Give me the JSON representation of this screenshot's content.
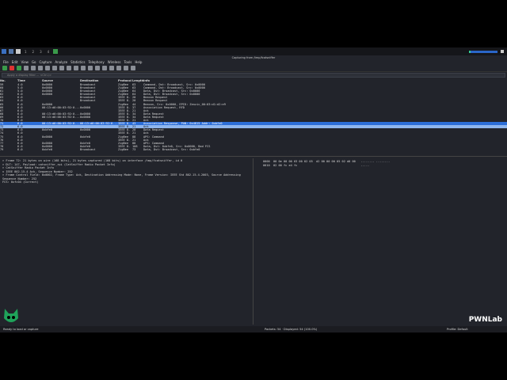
{
  "window": {
    "title": "Capturing from /tmp/fcatsniffer",
    "workspaces": [
      "1",
      "2",
      "3",
      "4"
    ]
  },
  "menu": [
    "File",
    "Edit",
    "View",
    "Go",
    "Capture",
    "Analyze",
    "Statistics",
    "Telephony",
    "Wireless",
    "Tools",
    "Help"
  ],
  "filter": {
    "placeholder": "Apply a display filter ... <Ctrl-/>"
  },
  "columns": [
    "No.",
    "Time",
    "Source",
    "Destination",
    "Protocol",
    "Length",
    "Info"
  ],
  "packets": [
    [
      "59",
      "4.0",
      "0x0000",
      "Broadcast",
      "ZigBee",
      "63",
      "Command, Dst: Broadcast, Src: 0x0000"
    ],
    [
      "60",
      "5.0",
      "0x0000",
      "Broadcast",
      "ZigBee",
      "63",
      "Command, Dst: Broadcast, Src: 0x0000"
    ],
    [
      "61",
      "5.0",
      "0x0000",
      "Broadcast",
      "ZigBee",
      "64",
      "Data, Dst: Broadcast, Src: 0x0000"
    ],
    [
      "62",
      "6.0",
      "0x0000",
      "Broadcast",
      "ZigBee",
      "64",
      "Data, Dst: Broadcast, Src: 0x0000"
    ],
    [
      "63",
      "6.0",
      "",
      "Broadcast",
      "IEEE 8.",
      "20",
      "Beacon Request"
    ],
    [
      "64",
      "6.0",
      "",
      "Broadcast",
      "IEEE 8.",
      "20",
      "Beacon Request"
    ],
    [
      "65",
      "6.0",
      "0x0000",
      "",
      "ZigBee",
      "44",
      "Beacon, Src: 0x0000, EPID: Zenzic_00:03:d1:d2:e9"
    ],
    [
      "66",
      "6.0",
      "00:13:d0:00:03:92:0...",
      "0x0000",
      "IEEE 8.",
      "37",
      "Association Request, RFD"
    ],
    [
      "67",
      "6.0",
      "",
      "",
      "IEEE 8.",
      "21",
      "Ack"
    ],
    [
      "68",
      "6.0",
      "00:13:d0:00:03:92:0...",
      "0x0000",
      "IEEE 8.",
      "34",
      "Data Request"
    ],
    [
      "69",
      "6.0",
      "00:13:d0:00:03:92:0...",
      "0x0000",
      "IEEE 8.",
      "34",
      "Data Request"
    ],
    [
      "70",
      "6.0",
      "",
      "",
      "IEEE 8.",
      "21",
      "Ack"
    ],
    [
      "71",
      "6.0",
      "00:13:d0:00:03:92:0...",
      "00:13:d0:00:03:92:0...",
      "IEEE 8.",
      "43",
      "Association Response, PAN: 0x4815 Addr: 0xbfe0"
    ],
    [
      "72",
      "6.0",
      "",
      "",
      "IEEE 8.",
      "21",
      "Ack"
    ],
    [
      "73",
      "6.0",
      "0xbfe0",
      "0x0000",
      "IEEE 8.",
      "20",
      "Data Request"
    ],
    [
      "74",
      "6.0",
      "",
      "",
      "IEEE 8.",
      "21",
      "Ack"
    ],
    [
      "75",
      "6.0",
      "0x0000",
      "0xbfe0",
      "ZigBee",
      "88",
      "APS: Command"
    ],
    [
      "76",
      "6.0",
      "",
      "",
      "IEEE 8.",
      "21",
      "Ack"
    ],
    [
      "77",
      "6.0",
      "0x0000",
      "0xbfe0",
      "ZigBee",
      "88",
      "APS: Command"
    ],
    [
      "78",
      "6.0",
      "0x0000",
      "0xbfe0",
      "IEEE 8.",
      "108",
      "Data, Dst: 0xbfe0, Src: 0x0000, Bad FCS"
    ],
    [
      "79",
      "6.0",
      "0xbfe0",
      "Broadcast",
      "ZigBee",
      "73",
      "Data, Dst: Broadcast, Src: 0xbfe0"
    ]
  ],
  "details": [
    "> Frame 72: 21 bytes on wire (168 bits), 21 bytes captured (168 bits) on interface /tmp/fcatsniffer, id 0",
    "> DLT: 147, Payload: catsniffer_rpi (CatSniffer Radio Packet Info)",
    "> CatSniffer Radio Packet Info",
    "v IEEE 802.15.4 Ack, Sequence Number: 252",
    "   > Frame Control Field: 0x0002, Frame Type: Ack, Destination Addressing Mode: None, Frame Version: IEEE Std 802.15.4-2003, Source Addressing",
    "     Sequence Number: 252",
    "     FCS: 0xfc04 (Correct)"
  ],
  "hex": [
    "0000  00 0e 00 00 03 00 02 05  d2 00 00 00 05 02 d0 00   ........ ........",
    "0010  02 00 fc e4 fc                                     ....."
  ],
  "status": {
    "left": "Ready to load or capture",
    "middle": "Packets: 54 · Displayed: 54 (100.0%)",
    "right": "Profile: Default"
  },
  "logo": "PWNLab"
}
